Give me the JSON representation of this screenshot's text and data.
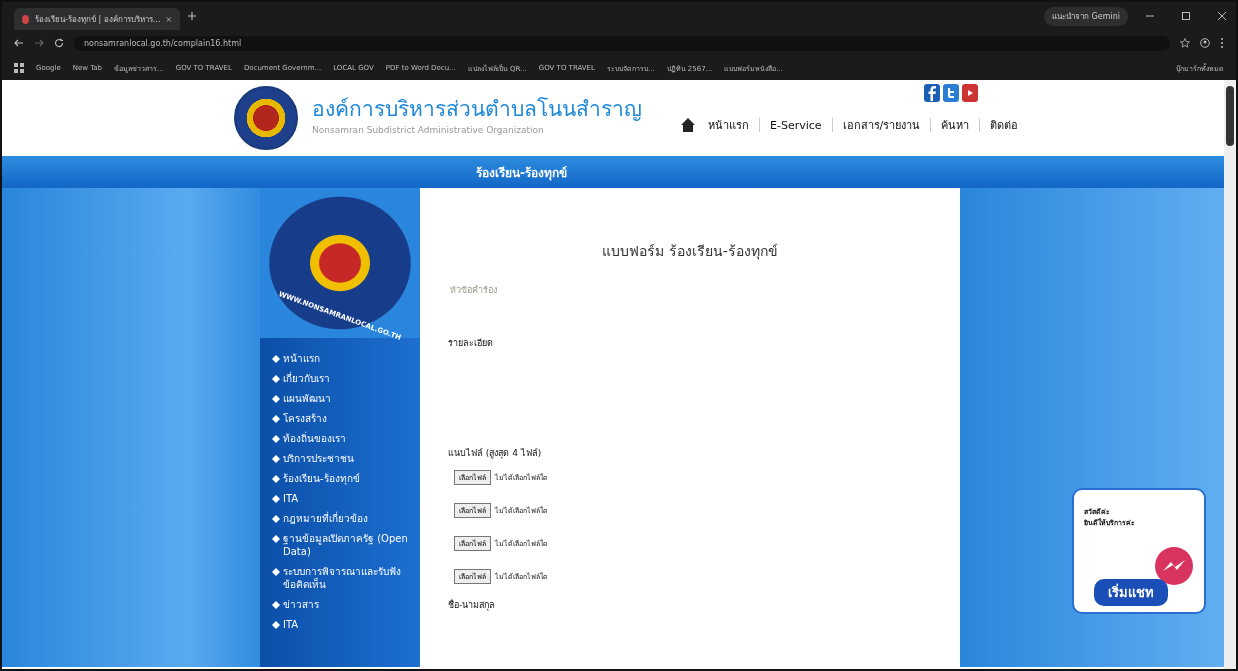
{
  "browser": {
    "tab_title": "ร้องเรียน-ร้องทุกข์ | องค์การบริหาร...",
    "url": "nonsamranlocal.go.th/complain16.html",
    "gemini_pill": "แนะนำจาก Gemini",
    "bookmarks": [
      {
        "label": "Google"
      },
      {
        "label": "New Tab"
      },
      {
        "label": "ข้อมูลข่าวสาร..."
      },
      {
        "label": "GOV TO TRAVEL"
      },
      {
        "label": "Document Governm..."
      },
      {
        "label": "LOCAL GOV"
      },
      {
        "label": "PDF to Word Docu..."
      },
      {
        "label": "แปลงไฟล์เป็น QR..."
      },
      {
        "label": "GOV TO TRAVEL"
      },
      {
        "label": "ระบบจัดการบ..."
      },
      {
        "label": "ปฏิทิน 2567..."
      },
      {
        "label": "แบบฟอร์มหนังสือ..."
      }
    ],
    "all_bookmarks": "บุ๊กมาร์กทั้งหมด"
  },
  "site": {
    "title": "องค์การบริหารส่วนตำบลโนนสำราญ",
    "subtitle": "Nonsamran Subdistrict Administrative Organization",
    "nav": [
      {
        "label": "หน้าแรก"
      },
      {
        "label": "E-Service"
      },
      {
        "label": "เอกสาร/รายงาน"
      },
      {
        "label": "ค้นหา"
      },
      {
        "label": "ติดต่อ"
      }
    ],
    "banner": "ร้องเรียน-ร้องทุกข์",
    "logo_url": "WWW.NONSAMRANLOCAL.GO.TH"
  },
  "sidebar": {
    "items": [
      {
        "label": "หน้าแรก"
      },
      {
        "label": "เกี่ยวกับเรา"
      },
      {
        "label": "แผนพัฒนา"
      },
      {
        "label": "โครงสร้าง"
      },
      {
        "label": "ท้องถิ่นของเรา"
      },
      {
        "label": "บริการประชาชน"
      },
      {
        "label": "ร้องเรียน-ร้องทุกข์"
      },
      {
        "label": "ITA"
      },
      {
        "label": "กฎหมายที่เกี่ยวข้อง"
      },
      {
        "label": "ฐานข้อมูลเปิดภาครัฐ (Open Data)"
      },
      {
        "label": "ระบบการพิจารณาและรับฟังข้อคิดเห็น"
      },
      {
        "label": "ข่าวสาร"
      },
      {
        "label": "ITA"
      }
    ]
  },
  "form": {
    "title": "แบบฟอร์ม ร้องเรียน-ร้องทุกข์",
    "subject_placeholder": "หัวข้อคำร้อง",
    "detail_label": "รายละเอียด",
    "attach_label": "แนบไฟล์ (สูงสุด 4 ไฟล์)",
    "files": [
      {
        "button": "เลือกไฟล์",
        "status": "ไม่ได้เลือกไฟล์ใด"
      },
      {
        "button": "เลือกไฟล์",
        "status": "ไม่ได้เลือกไฟล์ใด"
      },
      {
        "button": "เลือกไฟล์",
        "status": "ไม่ได้เลือกไฟล์ใด"
      },
      {
        "button": "เลือกไฟล์",
        "status": "ไม่ได้เลือกไฟล์ใด"
      }
    ],
    "name_label": "ชื่อ-นามสกุล"
  },
  "chat": {
    "greeting": "สวัสดีค่ะ",
    "message": "ยินดีให้บริการค่ะ",
    "button": "เริ่มแชท"
  }
}
